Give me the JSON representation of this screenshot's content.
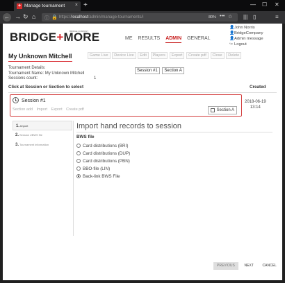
{
  "browser": {
    "tab_title": "Manage tournament",
    "tab_close": "×",
    "new_tab": "+",
    "back": "←",
    "forward": "→",
    "reload": "↻",
    "home": "⌂",
    "url_prefix": "https://",
    "url_host": "localhost",
    "url_path": "/admin/manage-tournaments/i",
    "zoom": "80%",
    "menu_dots": "•••",
    "star": "☆",
    "min": "—",
    "max": "☐",
    "close": "✕"
  },
  "logo": {
    "left": "BRIDGE",
    "plus": "+",
    "right": "MORE",
    "sub": "BRIDGE COMPANY"
  },
  "nav": {
    "me": "ME",
    "results": "RESULTS",
    "admin": "ADMIN",
    "general": "GENERAL"
  },
  "user": {
    "name": "John Norris",
    "company": "BridgeCompany",
    "message": "Admin message",
    "logout": "Logout"
  },
  "tournament": {
    "title": "My Unknown Mitchell",
    "actions": [
      "Game Live",
      "Device Live",
      "Edit",
      "Players",
      "Export",
      "Create pdf",
      "Close",
      "Delete"
    ],
    "details_label": "Tournament Details:",
    "name_line": "Tournament Name: My Unknown Mitchell",
    "sessions_label": "Sessions count:",
    "sessions_value": "1",
    "session_btn": "Session #1",
    "section_btn": "Section A"
  },
  "table": {
    "header_left": "Click at Session or Section to select",
    "header_right": "Created"
  },
  "session": {
    "title": "Session #1",
    "actions": [
      "Section add",
      "Import",
      "Export",
      "Create pdf"
    ],
    "section_btn": "Section A",
    "created_date": "2018-06-19",
    "created_time": "13:14"
  },
  "wizard": {
    "steps": [
      {
        "num": "1.",
        "label": "Import"
      },
      {
        "num": "2.",
        "label": "Session #BWS file"
      },
      {
        "num": "3.",
        "label": "Tournament information"
      }
    ],
    "title": "Import hand records to session",
    "file_label": "BWS file",
    "options": [
      {
        "label": "Card distributions (BRI)",
        "checked": false
      },
      {
        "label": "Card distributions (DUP)",
        "checked": false
      },
      {
        "label": "Card distributions (PBN)",
        "checked": false
      },
      {
        "label": "BBO-file (LIN)",
        "checked": false
      },
      {
        "label": "Back-link BWS File",
        "checked": true
      }
    ],
    "previous": "PREVIOUS",
    "next": "NEXT",
    "cancel": "CANCEL"
  },
  "colors": {
    "brand_red": "#d7262c",
    "browser_dark": "#323234"
  }
}
